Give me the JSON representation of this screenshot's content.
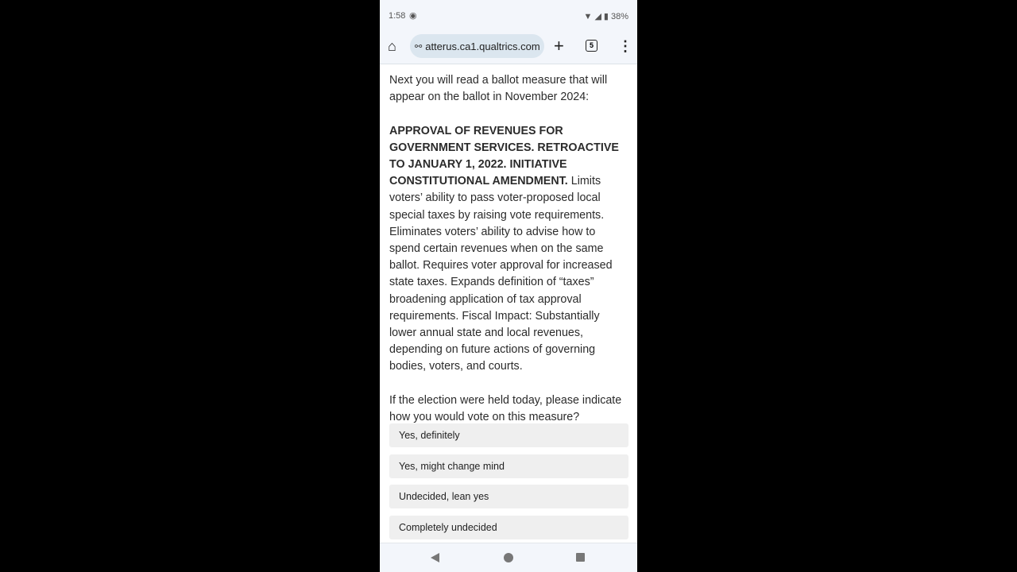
{
  "status_bar": {
    "time": "1:58",
    "battery": "38%"
  },
  "browser": {
    "url": "atterus.ca1.qualtrics.com",
    "tab_count": "5"
  },
  "survey": {
    "intro": "Next you will read a ballot measure that will appear on the ballot in November 2024:",
    "measure_title": "APPROVAL OF REVENUES FOR GOVERNMENT SERVICES. RETROACTIVE TO JANUARY 1, 2022. INITIATIVE CONSTITUTIONAL AMENDMENT.",
    "measure_text": " Limits voters’ ability to pass voter-proposed local special taxes by raising vote requirements. Eliminates voters’ ability to advise how to spend certain revenues when on the same ballot. Requires voter approval for increased state taxes. Expands definition of “taxes” broadening application of tax approval requirements. Fiscal Impact: Substantially lower annual state and local revenues, depending on future actions of governing bodies, voters, and courts.",
    "question": "If the election were held today, please indicate how you would vote on this measure?",
    "options": [
      "Yes, definitely",
      "Yes, might change mind",
      "Undecided, lean yes",
      "Completely undecided"
    ]
  }
}
